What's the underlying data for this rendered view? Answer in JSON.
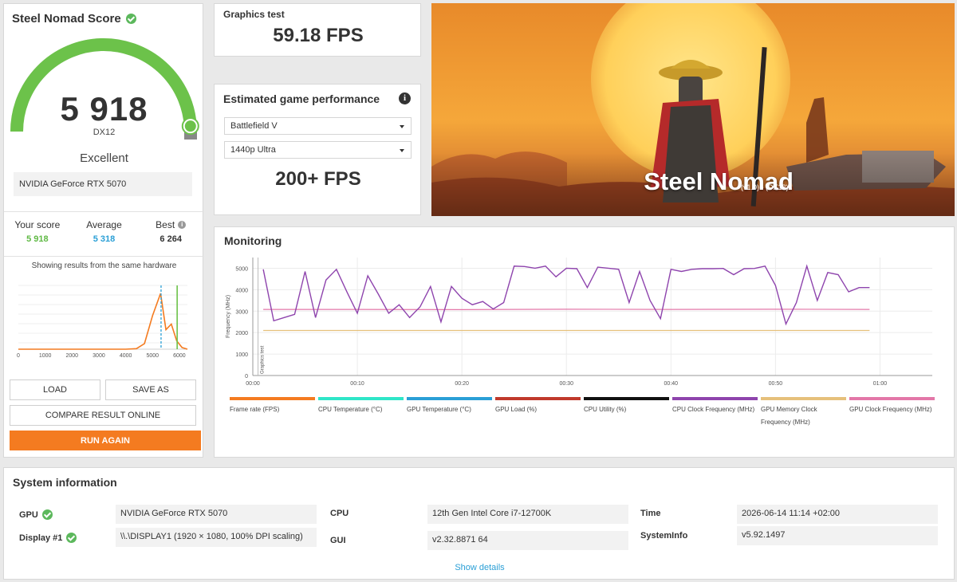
{
  "score_card": {
    "title": "Steel Nomad Score",
    "score": "5 918",
    "score_fraction": 0.98,
    "api": "DX12",
    "rating": "Excellent",
    "hardware": "NVIDIA GeForce RTX 5070",
    "stats": [
      {
        "label": "Your score",
        "value": "5 918",
        "color": "#5fb944"
      },
      {
        "label": "Average",
        "value": "5 318",
        "color": "#2a9fd6"
      },
      {
        "label": "Best",
        "value": "6 264",
        "color": "#333333"
      }
    ],
    "histogram_caption": "Showing results from the same hardware",
    "histogram": {
      "x_ticks": [
        "0",
        "1000",
        "2000",
        "3000",
        "4000",
        "5000",
        "6000"
      ],
      "xlim": [
        0,
        6300
      ],
      "distribution": [
        [
          0,
          0
        ],
        [
          4000,
          0
        ],
        [
          4400,
          1
        ],
        [
          4700,
          10
        ],
        [
          5000,
          60
        ],
        [
          5300,
          100
        ],
        [
          5500,
          35
        ],
        [
          5700,
          45
        ],
        [
          5900,
          15
        ],
        [
          6100,
          3
        ],
        [
          6300,
          0
        ]
      ],
      "average_marker": 5318,
      "your_score_marker": 5918
    },
    "buttons": {
      "load": "LOAD",
      "save_as": "SAVE AS",
      "compare": "COMPARE RESULT ONLINE",
      "run_again": "RUN AGAIN"
    }
  },
  "graphics_test": {
    "label": "Graphics test",
    "value": "59.18 FPS"
  },
  "estimated_performance": {
    "title": "Estimated game performance",
    "game": "Battlefield V",
    "settings": "1440p Ultra",
    "fps": "200+ FPS"
  },
  "hero": {
    "title": "Steel Nomad",
    "subtitle": "(v1.0) - (DX12)"
  },
  "monitoring": {
    "title": "Monitoring",
    "chart_data": {
      "type": "line",
      "ylabel": "Frequency (MHz)",
      "marker_label": "Graphics test",
      "ylim": [
        0,
        5500
      ],
      "y_ticks": [
        0,
        1000,
        2000,
        3000,
        4000,
        5000
      ],
      "xlim": [
        0,
        65
      ],
      "x_ticks": [
        "00:00",
        "00:10",
        "00:20",
        "00:30",
        "00:40",
        "00:50",
        "01:00"
      ],
      "series": [
        {
          "name": "CPU Clock Frequency (MHz)",
          "x": [
            1,
            2,
            3,
            4,
            5,
            6,
            7,
            8,
            9,
            10,
            11,
            12,
            13,
            14,
            15,
            16,
            17,
            18,
            19,
            20,
            21,
            22,
            23,
            24,
            25,
            26,
            27,
            28,
            29,
            30,
            31,
            32,
            33,
            34,
            35,
            36,
            37,
            38,
            39,
            40,
            41,
            42,
            43,
            44,
            45,
            46,
            47,
            48,
            49,
            50,
            51,
            52,
            53,
            54,
            55,
            56,
            57,
            58,
            59
          ],
          "y": [
            4950,
            2550,
            2700,
            2850,
            4850,
            2700,
            4450,
            4950,
            3900,
            2900,
            4650,
            3800,
            2900,
            3300,
            2700,
            3200,
            4150,
            2500,
            4150,
            3600,
            3300,
            3450,
            3100,
            3400,
            5100,
            5080,
            5000,
            5100,
            4600,
            5000,
            4980,
            4100,
            5050,
            5000,
            4950,
            3400,
            4850,
            3500,
            2650,
            4950,
            4850,
            4950,
            4980,
            4980,
            4990,
            4700,
            4980,
            4990,
            5100,
            4200,
            2400,
            3400,
            5100,
            3500,
            4800,
            4700,
            3900,
            4100,
            4100
          ]
        },
        {
          "name": "GPU Clock Frequency (MHz)",
          "x": [
            1,
            10,
            20,
            30,
            40,
            50,
            59
          ],
          "y": [
            3080,
            3080,
            3070,
            3090,
            3080,
            3090,
            3080
          ]
        },
        {
          "name": "GPU Memory Clock Frequency (MHz)",
          "x": [
            1,
            59
          ],
          "y": [
            2100,
            2100
          ]
        }
      ]
    },
    "legend": [
      {
        "label": "Frame rate (FPS)",
        "color": "#f47b20"
      },
      {
        "label": "CPU Temperature (°C)",
        "color": "#2ee6c8"
      },
      {
        "label": "GPU Temperature (°C)",
        "color": "#2a9fd6"
      },
      {
        "label": "GPU Load (%)",
        "color": "#c0392b"
      },
      {
        "label": "CPU Utility (%)",
        "color": "#111111"
      },
      {
        "label": "CPU Clock Frequency (MHz)",
        "color": "#8e44ad"
      },
      {
        "label": "GPU Memory Clock Frequency (MHz)",
        "color": "#e6c07b"
      },
      {
        "label": "GPU Clock Frequency (MHz)",
        "color": "#e377a8"
      }
    ]
  },
  "system_info": {
    "title": "System information",
    "gpu_label": "GPU",
    "gpu_value": "NVIDIA GeForce RTX 5070",
    "display_label": "Display #1",
    "display_value": "\\\\.\\DISPLAY1 (1920 × 1080, 100% DPI scaling)",
    "cpu_label": "CPU",
    "cpu_value": "12th Gen Intel Core i7-12700K",
    "gui_label": "GUI",
    "gui_value": "v2.32.8871 64",
    "time_label": "Time",
    "time_value": "2026-06-14 11:14 +02:00",
    "systeminfo_label": "SystemInfo",
    "systeminfo_value": "v5.92.1497",
    "show_details": "Show details"
  }
}
